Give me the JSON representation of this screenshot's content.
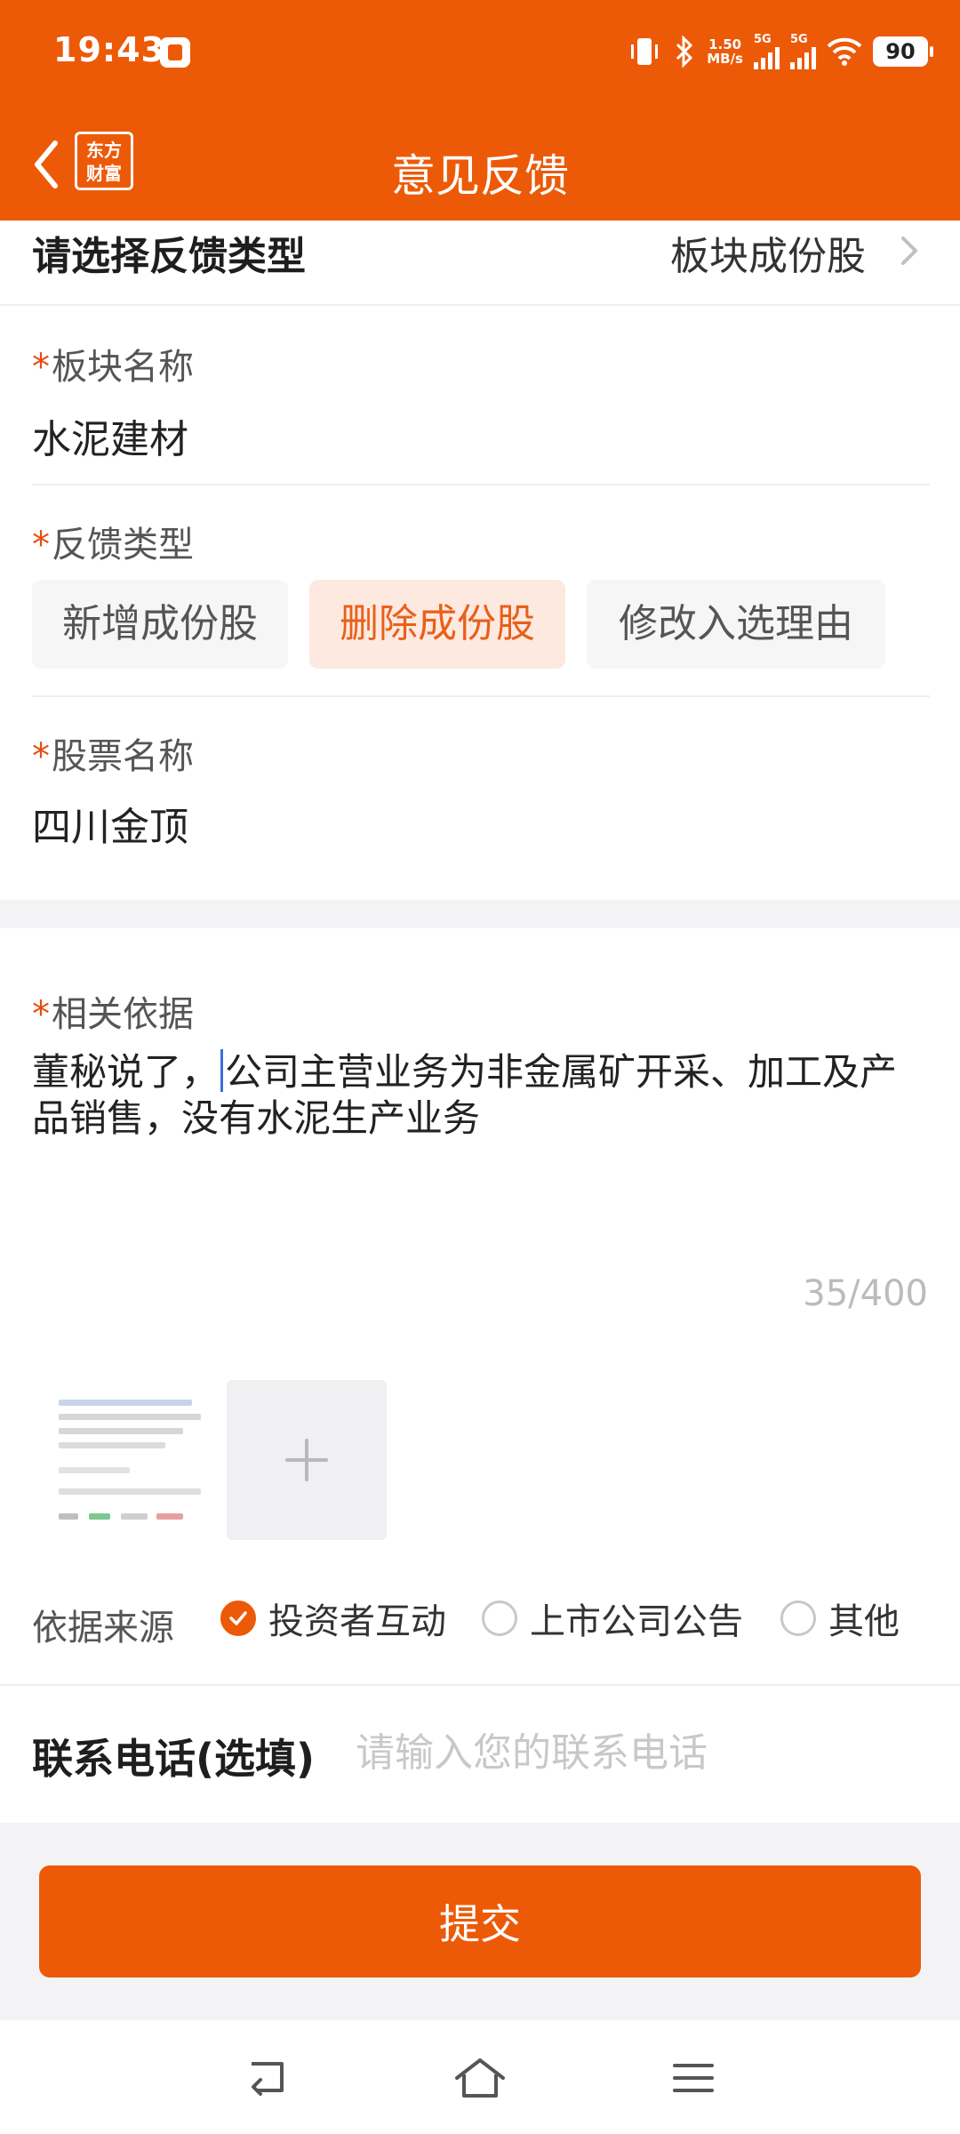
{
  "status_bar": {
    "time": "19:43",
    "speed_value": "1.50",
    "speed_unit": "MB/s",
    "net1": "5G",
    "net2": "5G",
    "battery": "90"
  },
  "header": {
    "title": "意见反馈",
    "logo_line1": "东方",
    "logo_line2": "财富"
  },
  "feedback_type_row": {
    "label": "请选择反馈类型",
    "value": "板块成份股"
  },
  "sector": {
    "label": "板块名称",
    "value": "水泥建材"
  },
  "feedback_kind": {
    "label": "反馈类型",
    "options": [
      "新增成份股",
      "删除成份股",
      "修改入选理由"
    ],
    "selected": "删除成份股"
  },
  "stock": {
    "label": "股票名称",
    "value": "四川金顶"
  },
  "evidence": {
    "label": "相关依据",
    "text_before_caret": "董秘说了，",
    "text_after_caret": "公司主营业务为非金属矿开采、加工及产品销售，没有水泥生产业务",
    "counter": "35/400"
  },
  "source": {
    "label": "依据来源",
    "options": [
      "投资者互动",
      "上市公司公告",
      "其他"
    ],
    "selected": "投资者互动"
  },
  "contact": {
    "label": "联系电话(选填)",
    "placeholder": "请输入您的联系电话"
  },
  "submit_label": "提交",
  "colors": {
    "brand": "#ec5a08",
    "chip_selected_bg": "#fde9df",
    "chip_selected_text": "#e8601a",
    "required_star": "#e64c12"
  },
  "icons": [
    "back-arrow-icon",
    "chevron-right-icon",
    "plus-icon",
    "check-icon",
    "system-back-icon",
    "system-home-icon",
    "system-menu-icon"
  ]
}
